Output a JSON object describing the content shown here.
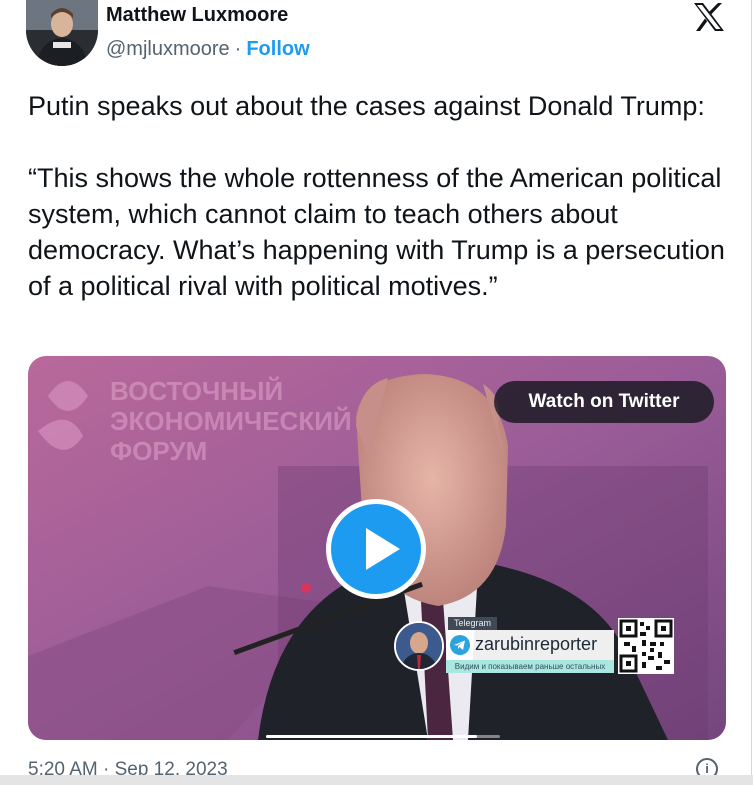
{
  "author": {
    "name": "Matthew Luxmoore",
    "handle": "@mjluxmoore",
    "separator": "·",
    "follow_label": "Follow"
  },
  "tweet": {
    "text": "Putin speaks out about the cases against Donald Trump:\n\n“This shows the whole rottenness of the American political system, which cannot claim to teach others about democracy. What’s happening with Trump is a persecution of a political rival with political motives.”",
    "timestamp": "5:20 AM · Sep 12, 2023"
  },
  "media": {
    "watch_label": "Watch on Twitter",
    "backdrop_text": [
      "ВОСТОЧНЫЙ",
      "ЭКОНОМИЧЕСКИЙ",
      "ФОРУМ"
    ],
    "overlay": {
      "tag": "Telegram",
      "channel": "zarubinreporter",
      "subtitle": "Видим и показываем раньше остальных"
    },
    "progress": 0.9
  },
  "icons": {
    "brand": "x-logo-icon",
    "play": "play-icon",
    "info": "info-icon"
  },
  "colors": {
    "accent": "#1d9bf0",
    "text_primary": "#0f1419",
    "text_secondary": "#536471"
  }
}
